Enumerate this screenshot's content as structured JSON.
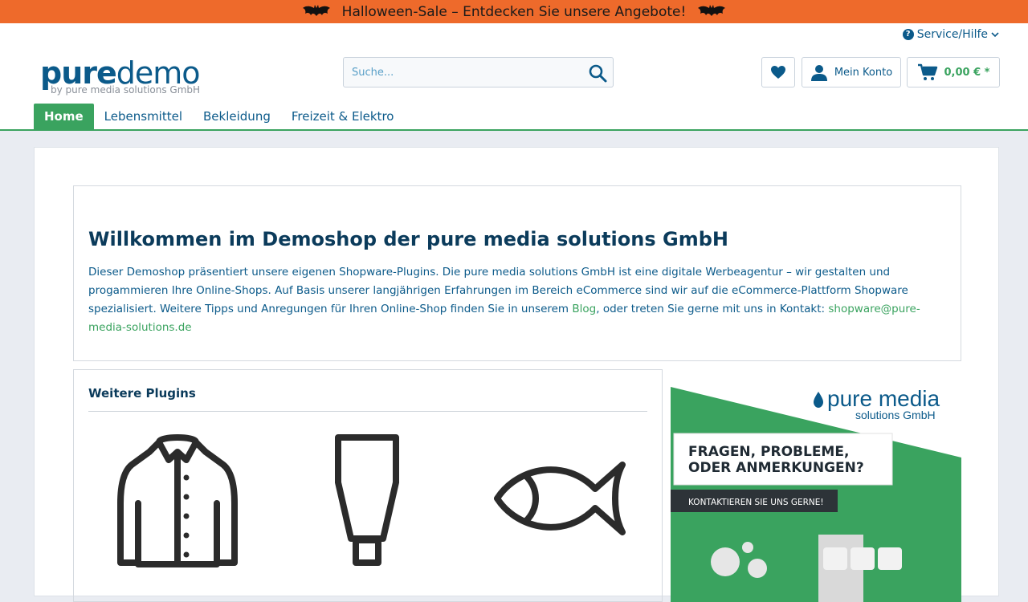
{
  "promo": {
    "text": "Halloween-Sale – Entdecken Sie unsere Angebote!",
    "icon": "bat-icon",
    "color": "#ee6a2b"
  },
  "header": {
    "service_label": "Service/Hilfe",
    "logo": {
      "pure": "pure",
      "demo": "demo",
      "tagline": "by pure media solutions GmbH"
    },
    "search_placeholder": "Suche...",
    "account_label": "Mein Konto",
    "cart_total": "0,00 € *"
  },
  "nav": {
    "items": [
      "Home",
      "Lebensmittel",
      "Bekleidung",
      "Freizeit & Elektro"
    ],
    "active": "Home"
  },
  "welcome": {
    "heading": "Willkommen im Demoshop der pure media solutions GmbH",
    "text_part1": "Dieser Demoshop präsentiert unsere eigenen Shopware-Plugins. Die pure media solutions GmbH ist eine digitale Werbeagentur – wir gestalten und progammieren Ihre Online-Shops. Auf Basis unserer langjährigen Erfahrungen im Bereich eCommerce sind wir auf die eCommerce-Plattform Shopware spezialisiert. Weitere Tipps und Anregungen für Ihren Online-Shop finden Sie in unserem ",
    "link_blog": "Blog",
    "text_part2": ", oder treten Sie gerne mit uns in Kontakt: ",
    "link_email": "shopware@pure-media-solutions.de"
  },
  "plugins": {
    "title": "Weitere Plugins",
    "icons": [
      "jacket-icon",
      "tube-icon",
      "fish-icon"
    ]
  },
  "banner": {
    "brand_line1": "pure media",
    "brand_line2": "solutions GmbH",
    "headline_line1": "FRAGEN, PROBLEME,",
    "headline_line2": "ODER ANMERKUNGEN?",
    "cta": "KONTAKTIEREN SIE UNS GERNE!",
    "accent": "#3aa35f"
  },
  "colors": {
    "brand_blue": "#0b5a8a",
    "brand_green": "#3aa35f",
    "dark_text": "#0b3b5b"
  }
}
